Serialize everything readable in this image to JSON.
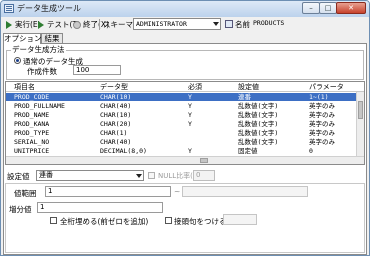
{
  "window": {
    "title": "データ生成ツール",
    "controls": {
      "minimize": "–",
      "maximize": "□",
      "close": "✕"
    }
  },
  "toolbar": {
    "run_label": "実行(E)",
    "test_label": "テスト(T)",
    "end_label": "終了(X)",
    "schema_label": "スキーマ",
    "schema_value": "ADMINISTRATOR",
    "name_label": "名前",
    "name_value": "PRODUCTS"
  },
  "tabs": [
    {
      "label": "オプション",
      "active": true
    },
    {
      "label": "結果",
      "active": false
    }
  ],
  "generation": {
    "group_title": "データ生成方法",
    "mode_label": "通常のデータ生成",
    "count_label": "作成件数",
    "count_value": "100"
  },
  "grid": {
    "columns": [
      "項目名",
      "データ型",
      "必須",
      "設定値",
      "パラメータ"
    ],
    "rows": [
      {
        "name": "PROD_CODE",
        "type": "CHAR(10)",
        "required": "Y",
        "setting": "連番",
        "param": "1~(1)",
        "selected": true
      },
      {
        "name": "PROD_FULLNAME",
        "type": "CHAR(40)",
        "required": "Y",
        "setting": "乱数値(文字)",
        "param": "英字のみ",
        "selected": false
      },
      {
        "name": "PROD_NAME",
        "type": "CHAR(10)",
        "required": "Y",
        "setting": "乱数値(文字)",
        "param": "英字のみ",
        "selected": false
      },
      {
        "name": "PROD_KANA",
        "type": "CHAR(20)",
        "required": "Y",
        "setting": "乱数値(文字)",
        "param": "英字のみ",
        "selected": false
      },
      {
        "name": "PROD_TYPE",
        "type": "CHAR(1)",
        "required": "",
        "setting": "乱数値(文字)",
        "param": "英字のみ",
        "selected": false
      },
      {
        "name": "SERIAL_NO",
        "type": "CHAR(40)",
        "required": "",
        "setting": "乱数値(文字)",
        "param": "英字のみ",
        "selected": false
      },
      {
        "name": "UNITPRICE",
        "type": "DECIMAL(8,0)",
        "required": "Y",
        "setting": "固定値",
        "param": "0",
        "selected": false
      }
    ]
  },
  "settings": {
    "setting_label": "設定値",
    "setting_value": "連番",
    "null_ratio_label": "NULL比率(%)",
    "null_ratio_value": "0",
    "initial_label": "値範囲",
    "initial_value": "1",
    "range_separator": "~",
    "increment_label": "増分値",
    "increment_value": "1",
    "zero_fill_label": "全桁埋める(前ゼロを追加)",
    "suffix_label": "接頭句をつける"
  },
  "colors": {
    "selection": "#3d6fc4",
    "titlebar": "#bcd2ec",
    "close_button": "#c7422c"
  }
}
